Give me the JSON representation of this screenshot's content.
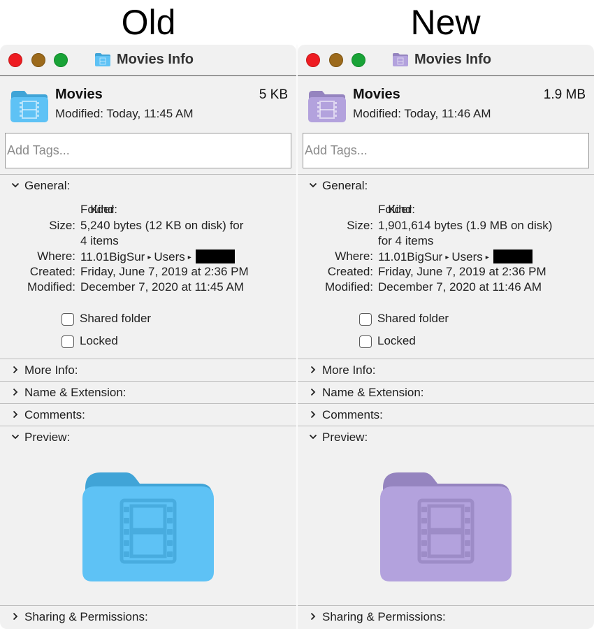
{
  "labels": {
    "old": "Old",
    "new": "New"
  },
  "panels": {
    "old": {
      "window_title": "Movies Info",
      "name": "Movies",
      "size": "5 KB",
      "modified_label": "Modified:",
      "modified": "Today, 11:45 AM",
      "tags_placeholder": "Add Tags...",
      "general": {
        "title": "General:",
        "kind_label": "Kind:",
        "kind": "Folder",
        "size_label": "Size:",
        "size_line1": "5,240 bytes (12 KB on disk) for",
        "size_line2": "4 items",
        "where_label": "Where:",
        "where_volume": "11.01BigSur",
        "where_users": "Users",
        "created_label": "Created:",
        "created": "Friday, June 7, 2019 at 2:36 PM",
        "modified_label": "Modified:",
        "modified": "December 7, 2020 at 11:45 AM"
      },
      "shared_folder": "Shared folder",
      "locked": "Locked",
      "sections": {
        "more_info": "More Info:",
        "name_extension": "Name & Extension:",
        "comments": "Comments:",
        "preview": "Preview:",
        "sharing": "Sharing & Permissions:"
      },
      "icon_color": "#5ec2f5"
    },
    "new": {
      "window_title": "Movies Info",
      "name": "Movies",
      "size": "1.9 MB",
      "modified_label": "Modified:",
      "modified": "Today, 11:46 AM",
      "tags_placeholder": "Add Tags...",
      "general": {
        "title": "General:",
        "kind_label": "Kind:",
        "kind": "Folder",
        "size_label": "Size:",
        "size_line1": "1,901,614 bytes (1.9 MB on disk)",
        "size_line2": "for 4 items",
        "where_label": "Where:",
        "where_volume": "11.01BigSur",
        "where_users": "Users",
        "created_label": "Created:",
        "created": "Friday, June 7, 2019 at 2:36 PM",
        "modified_label": "Modified:",
        "modified": "December 7, 2020 at 11:46 AM"
      },
      "shared_folder": "Shared folder",
      "locked": "Locked",
      "sections": {
        "more_info": "More Info:",
        "name_extension": "Name & Extension:",
        "comments": "Comments:",
        "preview": "Preview:",
        "sharing": "Sharing & Permissions:"
      },
      "icon_color": "#b3a2dd"
    }
  },
  "colors": {
    "close": "#ee1c22",
    "minimize": "#9c6a1c",
    "zoom": "#19a337"
  }
}
